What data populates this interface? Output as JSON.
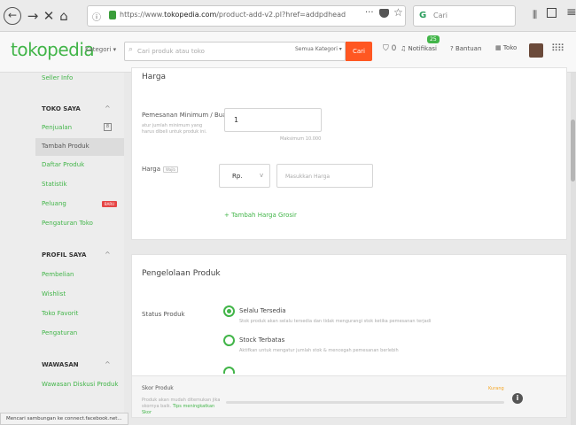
{
  "browser": {
    "nav": {
      "back": "←",
      "forward": "→",
      "close": "✕",
      "home": "⌂"
    },
    "url_prefix": "https://www.",
    "url_domain": "tokopedia.com",
    "url_path": "/product-add-v2.pl?href=addpdhead",
    "url_menu": "···",
    "search_placeholder": "Cari",
    "icons": [
      "info-icon",
      "lock-icon",
      "pocket-icon",
      "star-icon",
      "library-icon",
      "sidebar-icon",
      "hamburger-icon"
    ]
  },
  "header": {
    "logo": "tokopedia",
    "kategori": "Kategori ▾",
    "search_placeholder": "Cari produk atau toko",
    "semua_kategori": "Semua Kategori ▾",
    "cari_button": "Cari",
    "cart_count": "0",
    "notifikasi": "Notifikasi",
    "notif_badge": "25",
    "bantuan": "Bantuan",
    "toko": "Toko",
    "brand_color": "#42b549",
    "accent_color": "#ff5722"
  },
  "sidebar": {
    "seller_info": "Seller Info",
    "toko_saya": "TOKO SAYA",
    "penjualan": "Penjualan",
    "penjualan_count": "8",
    "tambah_produk": "Tambah Produk",
    "daftar_produk": "Daftar Produk",
    "statistik": "Statistik",
    "peluang": "Peluang",
    "peluang_badge": "BARU",
    "pengaturan_toko": "Pengaturan Toko",
    "profil_saya": "PROFIL SAYA",
    "pembelian": "Pembelian",
    "wishlist": "Wishlist",
    "toko_favorit": "Toko Favorit",
    "pengaturan": "Pengaturan",
    "wawasan": "WAWASAN",
    "wawasan_diskusi": "Wawasan Diskusi Produk"
  },
  "harga": {
    "title": "Harga",
    "pemesanan_label": "Pemesanan Minimum / Buah",
    "pemesanan_help": "atur jumlah minimum yang harus dibeli untuk produk ini.",
    "pemesanan_value": "1",
    "maksimum_hint": "Maksimum 10.000",
    "harga_label": "Harga",
    "wajib": "Wajib",
    "currency": "Rp.",
    "harga_placeholder": "Masukkan Harga",
    "grosir_link": "+ Tambah Harga Grosir"
  },
  "pengelolaan": {
    "title": "Pengelolaan Produk",
    "status_label": "Status Produk",
    "option1_label": "Selalu Tersedia",
    "option1_desc": "Stok produk akan selalu tersedia dan tidak mengurangi stok ketika pemesanan terjadi",
    "option2_label": "Stock Terbatas",
    "option2_desc": "Aktifkan untuk mengatur jumlah stok & mencegah pemesanan berlebih",
    "selected_option": "Selalu Tersedia"
  },
  "skor": {
    "title": "Skor Produk",
    "help": "Produk akan mudah ditemukan jika skornya baik.",
    "tips": "Tips meningkatkan Skor",
    "status": "Kurang",
    "progress": 0.0
  },
  "status_bar": "Mencari sambungan ke connect.facebook.net..."
}
